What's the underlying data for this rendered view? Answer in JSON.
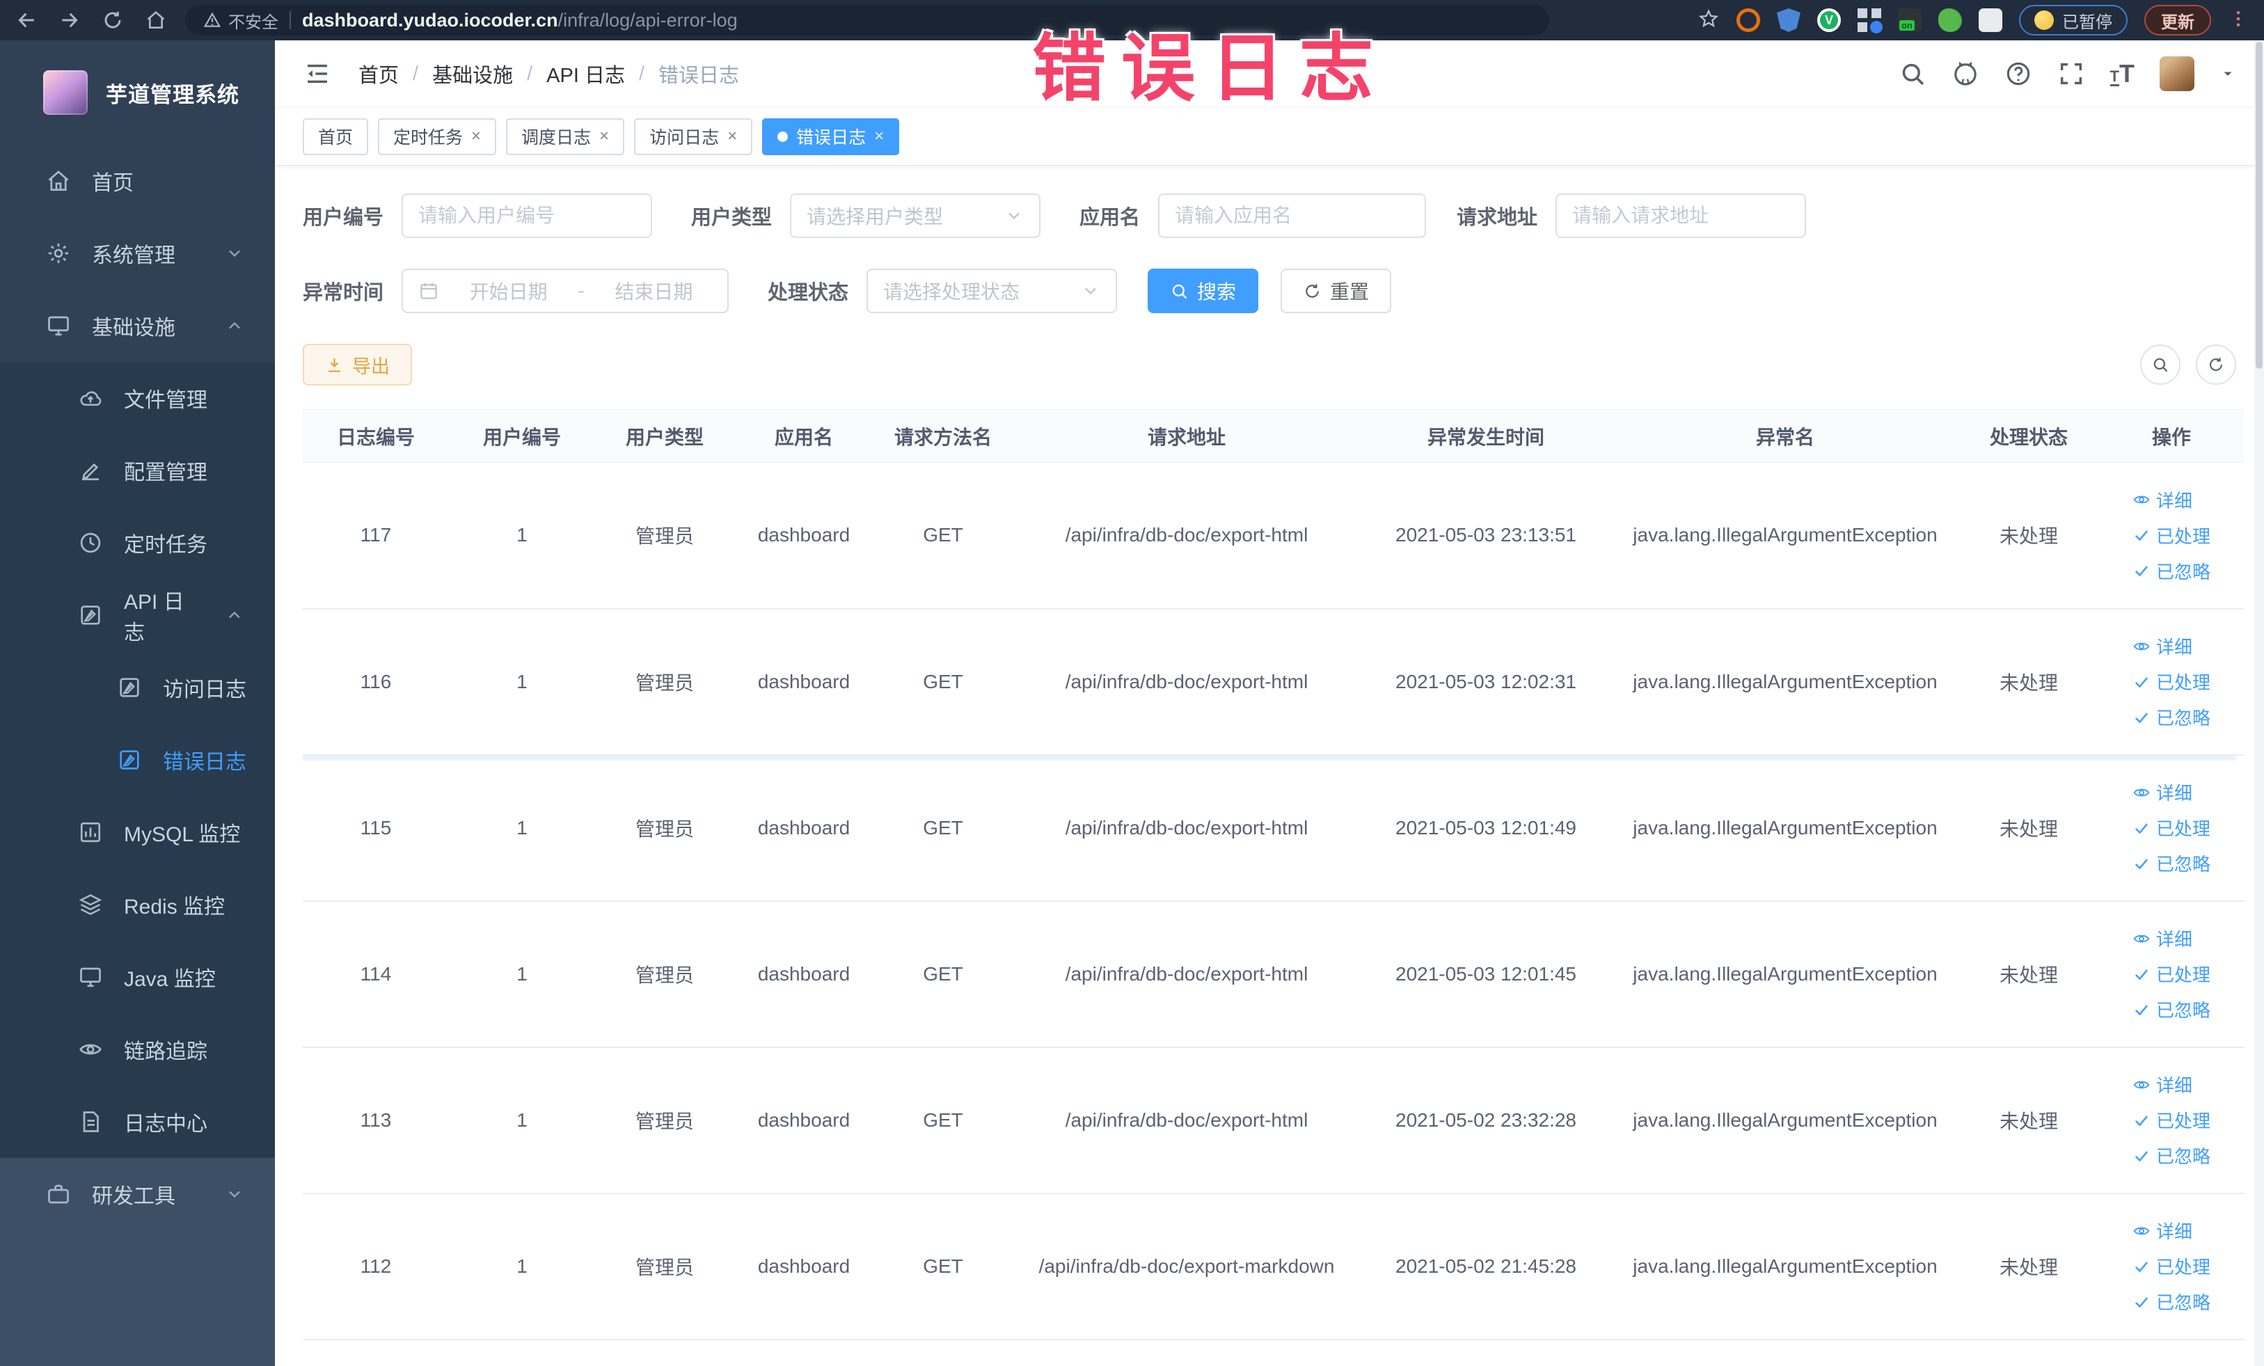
{
  "browser": {
    "security_label": "不安全",
    "url_host": "dashboard.yudao.iocoder.cn",
    "url_path": "/infra/log/api-error-log",
    "paused_label": "已暂停",
    "update_label": "更新"
  },
  "overlay_title": "错误日志",
  "sidebar": {
    "app_title": "芋道管理系统",
    "items": [
      {
        "label": "首页"
      },
      {
        "label": "系统管理"
      },
      {
        "label": "基础设施"
      },
      {
        "label": "文件管理"
      },
      {
        "label": "配置管理"
      },
      {
        "label": "定时任务"
      },
      {
        "label": "API 日志"
      },
      {
        "label": "访问日志"
      },
      {
        "label": "错误日志"
      },
      {
        "label": "MySQL 监控"
      },
      {
        "label": "Redis 监控"
      },
      {
        "label": "Java 监控"
      },
      {
        "label": "链路追踪"
      },
      {
        "label": "日志中心"
      },
      {
        "label": "研发工具"
      }
    ]
  },
  "breadcrumb": {
    "separator": "/",
    "items": [
      "首页",
      "基础设施",
      "API 日志",
      "错误日志"
    ]
  },
  "tabs": {
    "close_glyph": "×",
    "items": [
      "首页",
      "定时任务",
      "调度日志",
      "访问日志",
      "错误日志"
    ]
  },
  "filters": {
    "user_id_label": "用户编号",
    "user_id_placeholder": "请输入用户编号",
    "user_type_label": "用户类型",
    "user_type_placeholder": "请选择用户类型",
    "app_name_label": "应用名",
    "app_name_placeholder": "请输入应用名",
    "request_url_label": "请求地址",
    "request_url_placeholder": "请输入请求地址",
    "exception_time_label": "异常时间",
    "date_start_placeholder": "开始日期",
    "date_separator": "-",
    "date_end_placeholder": "结束日期",
    "process_status_label": "处理状态",
    "process_status_placeholder": "请选择处理状态",
    "search_label": "搜索",
    "reset_label": "重置"
  },
  "toolbar": {
    "export_label": "导出"
  },
  "table": {
    "columns": [
      "日志编号",
      "用户编号",
      "用户类型",
      "应用名",
      "请求方法名",
      "请求地址",
      "异常发生时间",
      "异常名",
      "处理状态",
      "操作"
    ],
    "actions": [
      "详细",
      "已处理",
      "已忽略"
    ],
    "rows": [
      {
        "id": "117",
        "user_id": "1",
        "user_type": "管理员",
        "app": "dashboard",
        "method": "GET",
        "url": "/api/infra/db-doc/export-html",
        "time": "2021-05-03 23:13:51",
        "exception": "java.lang.IllegalArgumentException",
        "status": "未处理"
      },
      {
        "id": "116",
        "user_id": "1",
        "user_type": "管理员",
        "app": "dashboard",
        "method": "GET",
        "url": "/api/infra/db-doc/export-html",
        "time": "2021-05-03 12:02:31",
        "exception": "java.lang.IllegalArgumentException",
        "status": "未处理"
      },
      {
        "id": "115",
        "user_id": "1",
        "user_type": "管理员",
        "app": "dashboard",
        "method": "GET",
        "url": "/api/infra/db-doc/export-html",
        "time": "2021-05-03 12:01:49",
        "exception": "java.lang.IllegalArgumentException",
        "status": "未处理"
      },
      {
        "id": "114",
        "user_id": "1",
        "user_type": "管理员",
        "app": "dashboard",
        "method": "GET",
        "url": "/api/infra/db-doc/export-html",
        "time": "2021-05-03 12:01:45",
        "exception": "java.lang.IllegalArgumentException",
        "status": "未处理"
      },
      {
        "id": "113",
        "user_id": "1",
        "user_type": "管理员",
        "app": "dashboard",
        "method": "GET",
        "url": "/api/infra/db-doc/export-html",
        "time": "2021-05-02 23:32:28",
        "exception": "java.lang.IllegalArgumentException",
        "status": "未处理"
      },
      {
        "id": "112",
        "user_id": "1",
        "user_type": "管理员",
        "app": "dashboard",
        "method": "GET",
        "url": "/api/infra/db-doc/export-markdown",
        "time": "2021-05-02 21:45:28",
        "exception": "java.lang.IllegalArgumentException",
        "status": "未处理"
      }
    ]
  },
  "colors": {
    "accent": "#409EFF",
    "warning": "#E6A23C",
    "overlay": "#F4436A",
    "sidebar_bg": "#304156"
  }
}
